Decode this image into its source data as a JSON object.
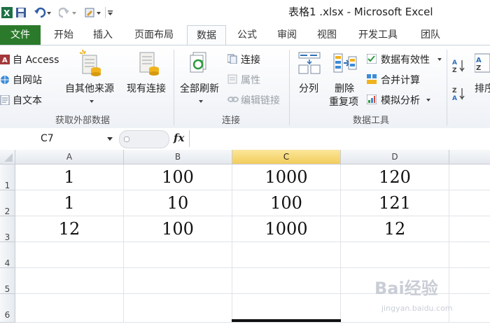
{
  "window": {
    "title": "表格1 .xlsx - Microsoft Excel"
  },
  "tabs": [
    {
      "label": "文件"
    },
    {
      "label": "开始"
    },
    {
      "label": "插入"
    },
    {
      "label": "页面布局"
    },
    {
      "label": "数据"
    },
    {
      "label": "公式"
    },
    {
      "label": "审阅"
    },
    {
      "label": "视图"
    },
    {
      "label": "开发工具"
    },
    {
      "label": "团队"
    }
  ],
  "ribbon": {
    "external": {
      "group_label": "获取外部数据",
      "from_access": "自 Access",
      "from_web": "自网站",
      "from_text": "自文本",
      "from_other_1": "自其他来源",
      "existing_conn": "现有连接"
    },
    "connections": {
      "group_label": "连接",
      "refresh_all": "全部刷新",
      "connections": "连接",
      "properties": "属性",
      "edit_links": "编辑链接"
    },
    "tools": {
      "group_label": "数据工具",
      "text_to_columns": "分列",
      "remove_dup_1": "删除",
      "remove_dup_2": "重复项",
      "validation": "数据有效性",
      "consolidate": "合并计算",
      "what_if": "模拟分析"
    },
    "sort": {
      "sort_label": "排序"
    }
  },
  "formula_bar": {
    "name_box": "C7",
    "fx": "fx",
    "content": ""
  },
  "sheet": {
    "columns": [
      "A",
      "B",
      "C",
      "D"
    ],
    "rows": [
      {
        "num": "1",
        "cells": [
          "1",
          "100",
          "1000",
          "120"
        ]
      },
      {
        "num": "2",
        "cells": [
          "1",
          "10",
          "100",
          "121"
        ]
      },
      {
        "num": "3",
        "cells": [
          "12",
          "100",
          "1000",
          "12"
        ]
      },
      {
        "num": "4",
        "cells": [
          "",
          "",
          "",
          ""
        ]
      },
      {
        "num": "5",
        "cells": [
          "",
          "",
          "",
          ""
        ]
      },
      {
        "num": "6",
        "cells": [
          "",
          "",
          "",
          ""
        ]
      }
    ],
    "selected_cell": "C7"
  },
  "watermark": {
    "brand": "Bai经验",
    "url": "jingyan.baidu.com"
  },
  "colors": {
    "file_tab": "#2b7a2b",
    "selected_header": "#f2cd5c"
  }
}
